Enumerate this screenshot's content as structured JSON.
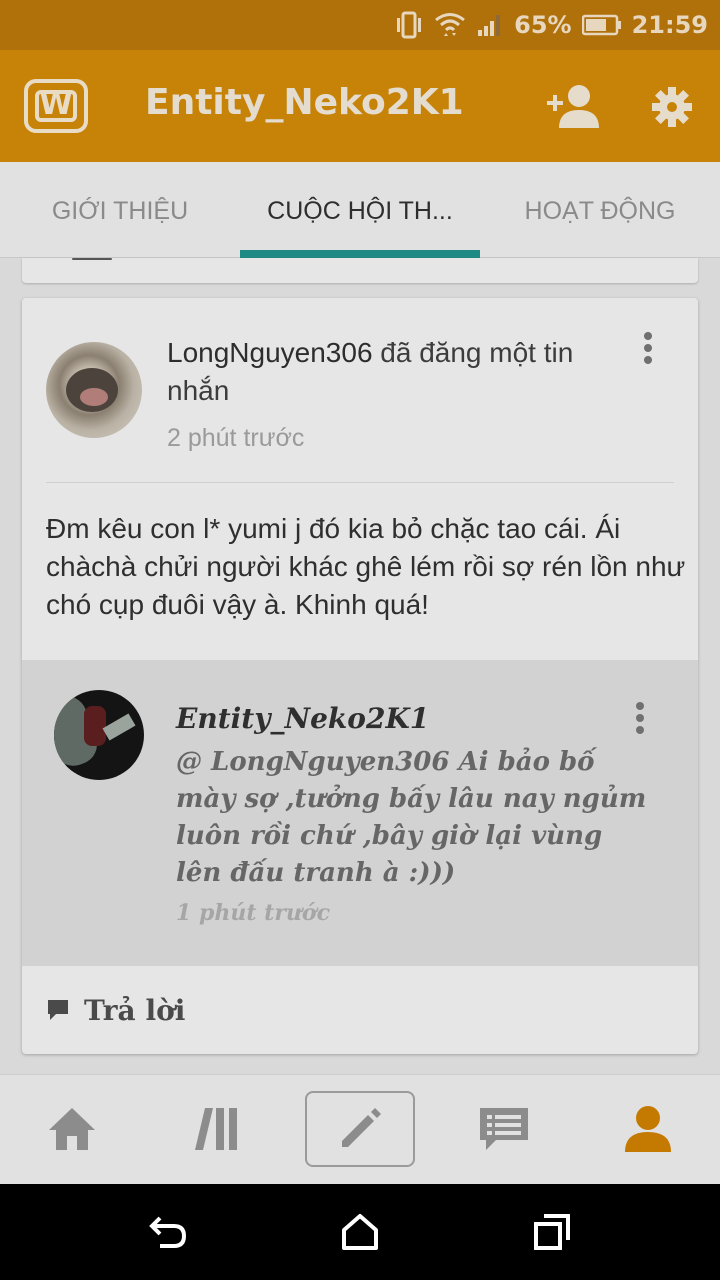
{
  "status_bar": {
    "battery": "65%",
    "time": "21:59"
  },
  "app_bar": {
    "logo_letter": "W",
    "title": "Entity_Neko2K1",
    "icons": [
      "add-user-icon",
      "settings-icon"
    ]
  },
  "tabs": [
    {
      "label": "GIỚI THIỆU"
    },
    {
      "label": "CUỘC HỘI TH..."
    },
    {
      "label": "HOẠT ĐỘNG"
    }
  ],
  "post": {
    "author": "LongNguyen306",
    "action": " đã đăng một tin nhắn",
    "time": "2 phút trước",
    "body": "Đm kêu con l* yumi j đó kia bỏ chặc tao cái. Ái chàchà chửi người khác ghê lém rồi sợ rén lồn như chó cụp đuôi vậy à. Khinh quá!"
  },
  "comment": {
    "author": "Entity_Neko2K1",
    "text": "@ LongNguyen306  Ai bảo bố mày sợ ,tưởng bấy lâu nay ngủm luôn rồi chứ ,bây giờ lại vùng lên đấu tranh à :)))",
    "time": "1 phút trước"
  },
  "reply": {
    "label": "Trả lời"
  },
  "bottom_nav": [
    "home-icon",
    "library-icon",
    "compose-icon",
    "messages-icon",
    "profile-icon"
  ],
  "colors": {
    "status_bar": "#b0700a",
    "app_bar": "#c78308",
    "tab_indicator": "#1d8a85",
    "profile_active": "#c47a00"
  }
}
